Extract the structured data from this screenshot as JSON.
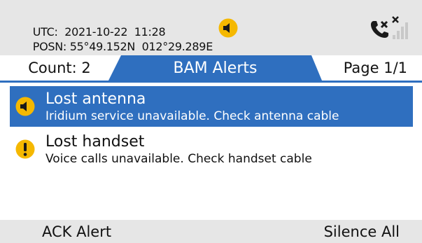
{
  "status": {
    "utc_label": "UTC:",
    "utc_value": "2021-10-22  11:28",
    "posn_label": "POSN:",
    "posn_value": "55°49.152N  012°29.289E",
    "alarm_icon": "speaker-icon",
    "phone_icon": "phone-no-call-icon",
    "signal_icon": "signal-strength-icon"
  },
  "tabs": {
    "count": "Count: 2",
    "title": "BAM Alerts",
    "page": "Page 1/1"
  },
  "alerts": [
    {
      "icon": "speaker-icon",
      "title": "Lost antenna",
      "description": "Iridium service unavailable. Check antenna cable",
      "selected": true
    },
    {
      "icon": "warning-icon",
      "title": "Lost handset",
      "description": "Voice calls unavailable. Check handset cable",
      "selected": false
    }
  ],
  "softkeys": {
    "left": "ACK Alert",
    "right": "Silence All"
  },
  "colors": {
    "accent": "#2f6fbf",
    "header_bg": "#e6e6e6",
    "alert_yellow": "#f5b800",
    "text": "#111111",
    "signal_inactive": "#c8c8c8"
  }
}
